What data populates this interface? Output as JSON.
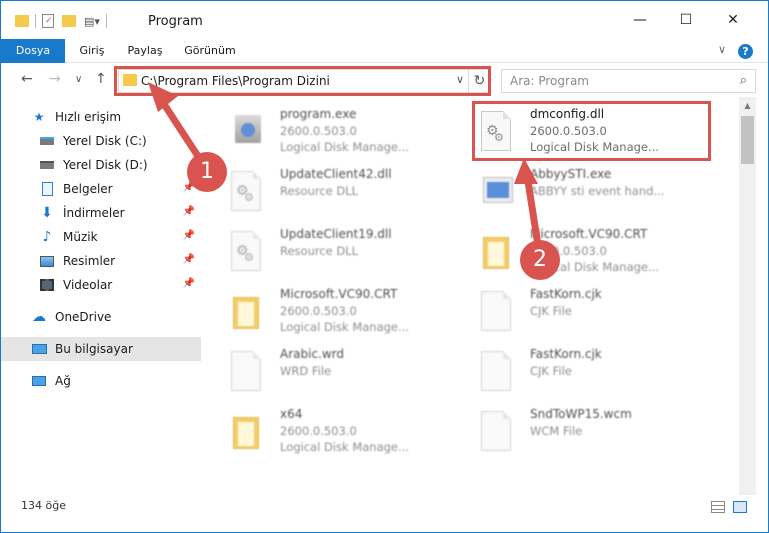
{
  "window": {
    "title": "Program",
    "minimize": "—",
    "maximize": "☐",
    "close": "✕"
  },
  "ribbon": {
    "tabs": [
      "Dosya",
      "Giriş",
      "Paylaş",
      "Görünüm"
    ],
    "expand": "∨",
    "help": "?"
  },
  "nav": {
    "back": "←",
    "forward": "→",
    "recent": "∨",
    "up": "↑",
    "address": "C:\\Program Files\\Program Dizini",
    "address_chevron": "∨",
    "refresh": "↻",
    "search_placeholder": "Ara: Program",
    "search_icon": "⌕"
  },
  "sidebar": {
    "items": [
      {
        "label": "Hızlı erişim",
        "icon": "star-icon"
      },
      {
        "label": "Yerel Disk (C:)",
        "icon": "drive-icon"
      },
      {
        "label": "Yerel Disk (D:)",
        "icon": "drive-icon"
      },
      {
        "label": "Belgeler",
        "icon": "documents-icon"
      },
      {
        "label": "İndirmeler",
        "icon": "download-icon"
      },
      {
        "label": "Müzik",
        "icon": "music-icon"
      },
      {
        "label": "Resimler",
        "icon": "pictures-icon"
      },
      {
        "label": "Videolar",
        "icon": "videos-icon"
      },
      {
        "label": "OneDrive",
        "icon": "cloud-icon"
      },
      {
        "label": "Bu bilgisayar",
        "icon": "computer-icon"
      },
      {
        "label": "Ağ",
        "icon": "network-icon"
      }
    ]
  },
  "files": [
    {
      "name": "program.exe",
      "line2": "2600.0.503.0",
      "line3": "Logical Disk Manage...",
      "kind": "exe"
    },
    {
      "name": "dmconfig.dll",
      "line2": "2600.0.503.0",
      "line3": "Logical Disk Manage...",
      "kind": "dll"
    },
    {
      "name": "UpdateClient42.dll",
      "line2": "Resource DLL",
      "line3": "",
      "kind": "dll"
    },
    {
      "name": "AbbyySTI.exe",
      "line2": "ABBYY sti event hand...",
      "line3": "",
      "kind": "exe"
    },
    {
      "name": "UpdateClient19.dll",
      "line2": "Resource DLL",
      "line3": "",
      "kind": "dll"
    },
    {
      "name": "Microsoft.VC90.CRT",
      "line2": "2600.0.503.0",
      "line3": "Logical Disk Manage...",
      "kind": "folder"
    },
    {
      "name": "Microsoft.VC90.CRT",
      "line2": "2600.0.503.0",
      "line3": "Logical Disk Manage...",
      "kind": "folder"
    },
    {
      "name": "FastKorn.cjk",
      "line2": "CJK File",
      "line3": "",
      "kind": "doc"
    },
    {
      "name": "Arabic.wrd",
      "line2": "WRD File",
      "line3": "",
      "kind": "doc"
    },
    {
      "name": "FastKorn.cjk",
      "line2": "CJK File",
      "line3": "",
      "kind": "doc"
    },
    {
      "name": "x64",
      "line2": "2600.0.503.0",
      "line3": "Logical Disk Manage...",
      "kind": "folder"
    },
    {
      "name": "SndToWP15.wcm",
      "line2": "WCM File",
      "line3": "",
      "kind": "doc"
    }
  ],
  "status": {
    "count": "134 öğe"
  },
  "annotations": {
    "badge1": "1",
    "badge2": "2"
  },
  "colors": {
    "accent": "#1979ca",
    "highlight": "#d9534f"
  }
}
